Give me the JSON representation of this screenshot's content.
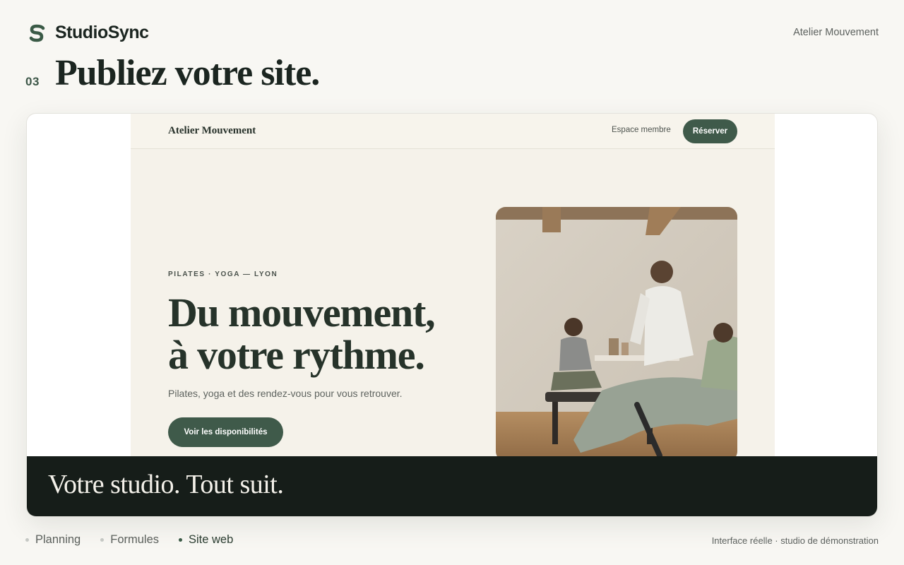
{
  "brand": {
    "name": "StudioSync",
    "icon": "s-logo-icon"
  },
  "header": {
    "studio_name": "Atelier Mouvement"
  },
  "step": {
    "number": "03",
    "title": "Publiez votre site."
  },
  "site_preview": {
    "logo": "Atelier Mouvement",
    "member_link": "Espace membre",
    "reserve_button": "Réserver",
    "eyebrow": "PILATES · YOGA — LYON",
    "hero_title_line1": "Du mouvement,",
    "hero_title_line2": "à votre rythme.",
    "hero_subtitle": "Pilates, yoga et des rendez-vous pour vous retrouver.",
    "cta_button": "Voir les disponibilités"
  },
  "banner": {
    "text": "Votre studio. Tout suit."
  },
  "bottom_nav": {
    "items": [
      {
        "label": "Planning",
        "active": false
      },
      {
        "label": "Formules",
        "active": false
      },
      {
        "label": "Site web",
        "active": true
      }
    ]
  },
  "footnote": "Interface réelle · studio de démonstration",
  "colors": {
    "accent": "#3f5a4a",
    "dark": "#161d19",
    "background": "#f8f7f3",
    "site_background": "#f5f2ea"
  }
}
